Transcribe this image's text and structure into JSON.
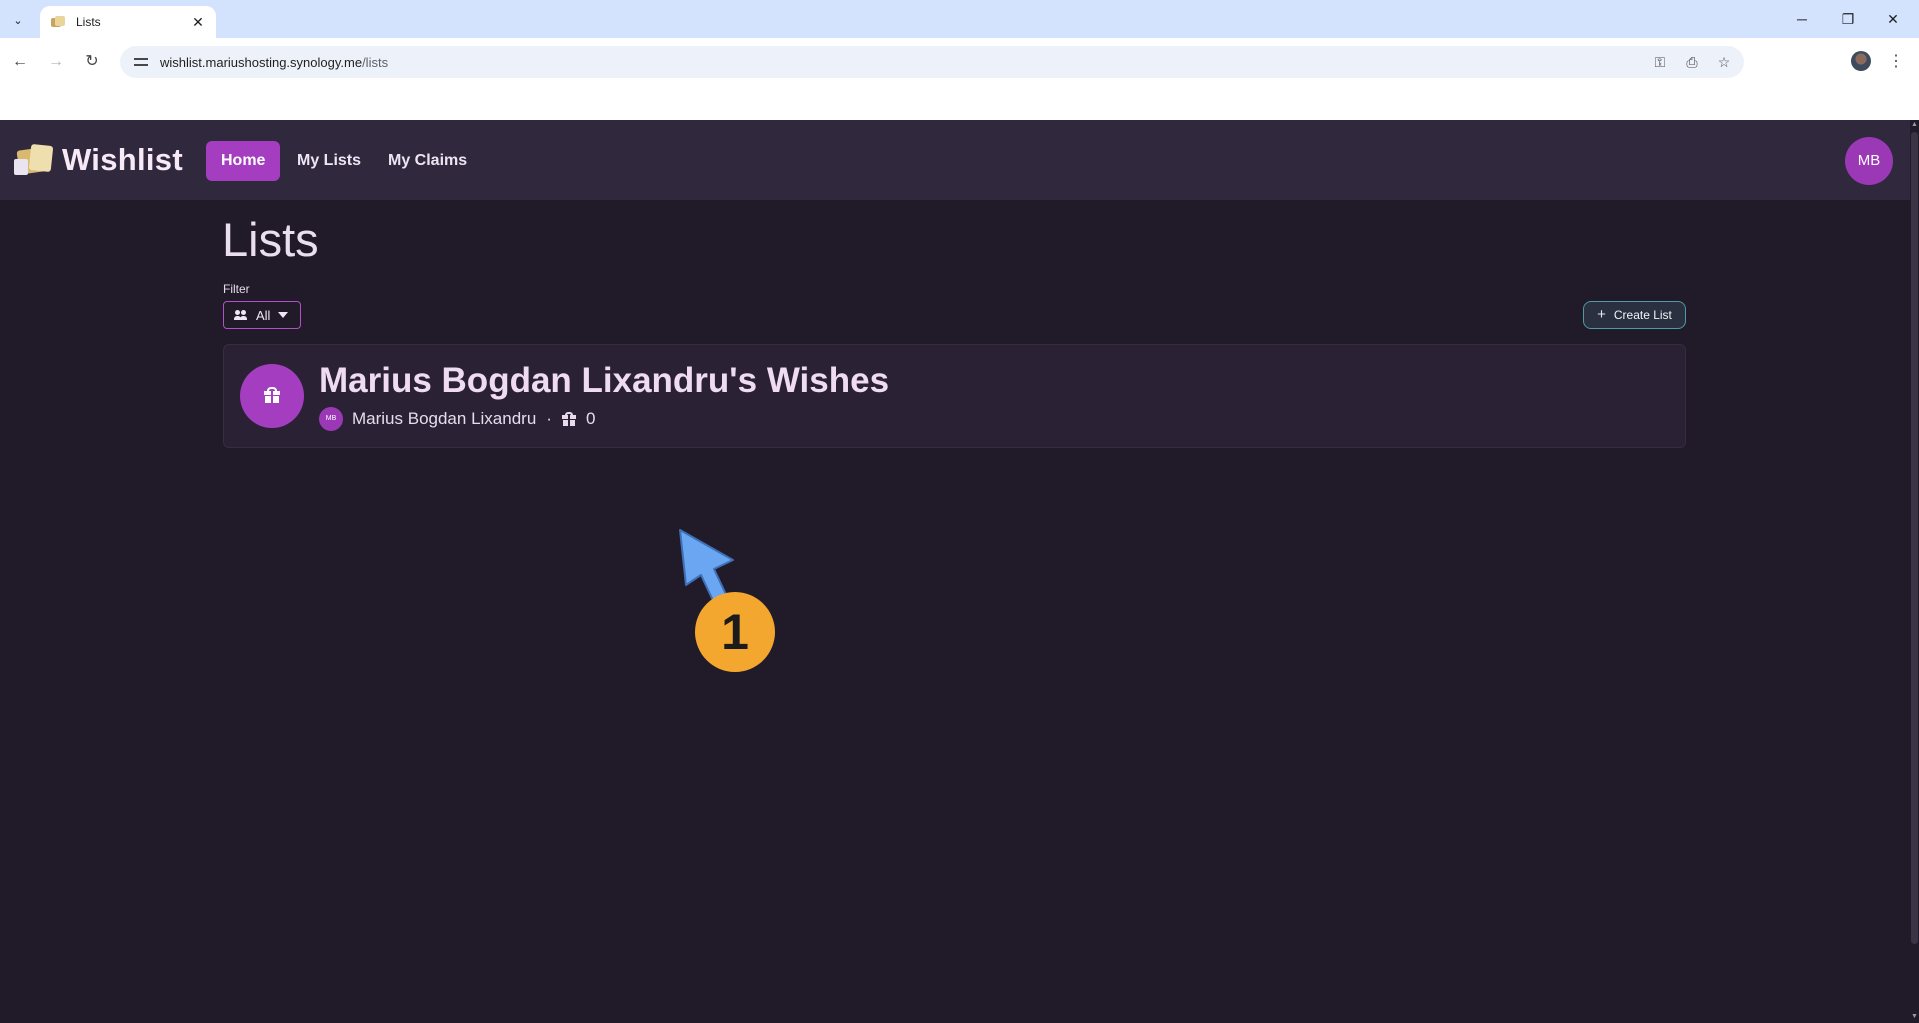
{
  "browser": {
    "tab_title": "Lists",
    "url_host": "wishlist.mariushosting.synology.me",
    "url_path": "/lists"
  },
  "app": {
    "brand": "Wishlist",
    "nav": [
      {
        "label": "Home",
        "active": true
      },
      {
        "label": "My Lists",
        "active": false
      },
      {
        "label": "My Claims",
        "active": false
      }
    ],
    "user_initials": "MB",
    "accent_color": "#a53dc0"
  },
  "page": {
    "title": "Lists",
    "filter_label": "Filter",
    "filter_value": "All",
    "create_button": "Create List"
  },
  "lists": [
    {
      "title": "Marius Bogdan Lixandru's Wishes",
      "owner_initials": "MB",
      "owner_name": "Marius Bogdan Lixandru",
      "separator": "·",
      "item_count": "0"
    }
  ],
  "annotation": {
    "step_number": "1",
    "badge_color": "#f4a72f",
    "arrow_color": "#6aa6f2"
  }
}
